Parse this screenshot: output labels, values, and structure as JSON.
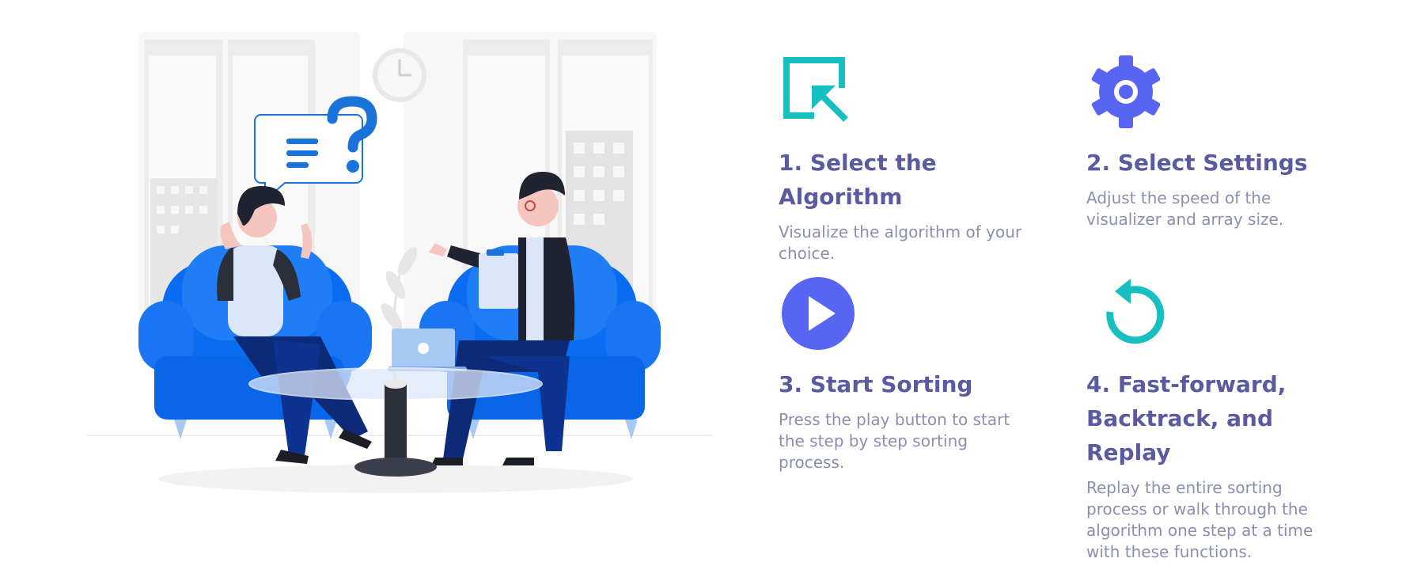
{
  "steps": [
    {
      "title": "1. Select the Algorithm",
      "description": "Visualize the algorithm of your choice.",
      "icon": "cursor-select-icon",
      "color": "#17bfc1"
    },
    {
      "title": "2. Select Settings",
      "description": "Adjust the speed of the visualizer and array size.",
      "icon": "gear-icon",
      "color": "#5865f2"
    },
    {
      "title": "3. Start Sorting",
      "description": "Press the play button to start the step by step sorting process.",
      "icon": "play-icon",
      "color": "#5865f2"
    },
    {
      "title": "4. Fast-forward, Backtrack, and Replay",
      "description": "Replay the entire sorting process or walk through the algorithm one step at a time with these functions.",
      "icon": "replay-icon",
      "color": "#17bfc1"
    }
  ]
}
